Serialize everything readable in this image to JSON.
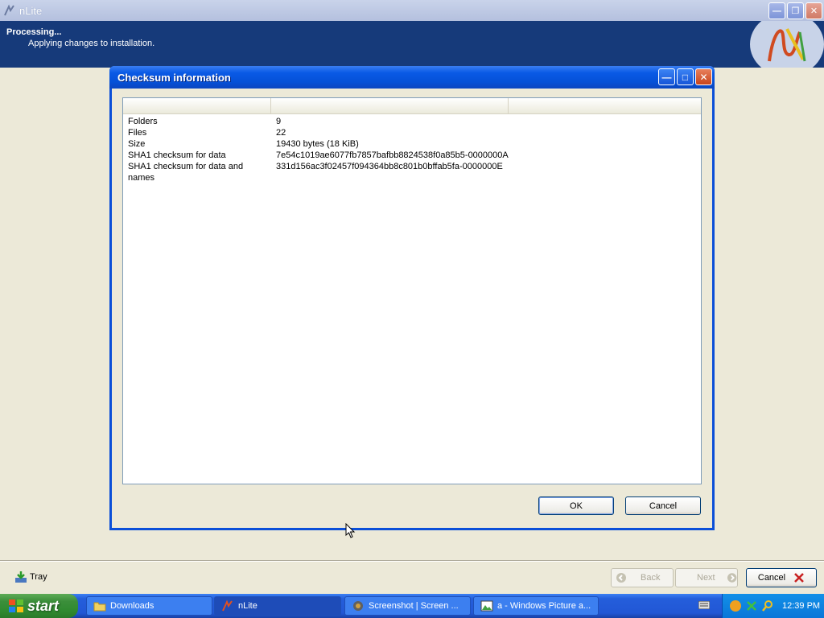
{
  "main_window": {
    "title": "nLite",
    "header_title": "Processing...",
    "header_subtitle": "Applying changes to installation."
  },
  "dialog": {
    "title": "Checksum information",
    "rows": [
      {
        "label": "Folders",
        "value": "9"
      },
      {
        "label": "Files",
        "value": "22"
      },
      {
        "label": "Size",
        "value": "19430 bytes (18 KiB)"
      },
      {
        "label": "SHA1 checksum for data",
        "value": "7e54c1019ae6077fb7857bafbb8824538f0a85b5-0000000A"
      },
      {
        "label": "SHA1 checksum for data and names",
        "value": "331d156ac3f02457f094364bb8c801b0bffab5fa-0000000E"
      }
    ],
    "ok_label": "OK",
    "cancel_label": "Cancel"
  },
  "bottom_bar": {
    "tray_label": "Tray",
    "back_label": "Back",
    "next_label": "Next",
    "cancel_label": "Cancel"
  },
  "taskbar": {
    "start_label": "start",
    "tasks": [
      {
        "label": "Downloads",
        "icon": "folder-icon"
      },
      {
        "label": "nLite",
        "icon": "nlite-icon"
      },
      {
        "label": "Screenshot | Screen ...",
        "icon": "screenshot-icon"
      },
      {
        "label": "a - Windows Picture a...",
        "icon": "picture-viewer-icon"
      }
    ],
    "clock": "12:39 PM"
  },
  "colors": {
    "header_band": "#163a7a",
    "dialog_titlebar": "#0a5ae6",
    "taskbar": "#245edb",
    "start_button": "#3c8f3b"
  }
}
